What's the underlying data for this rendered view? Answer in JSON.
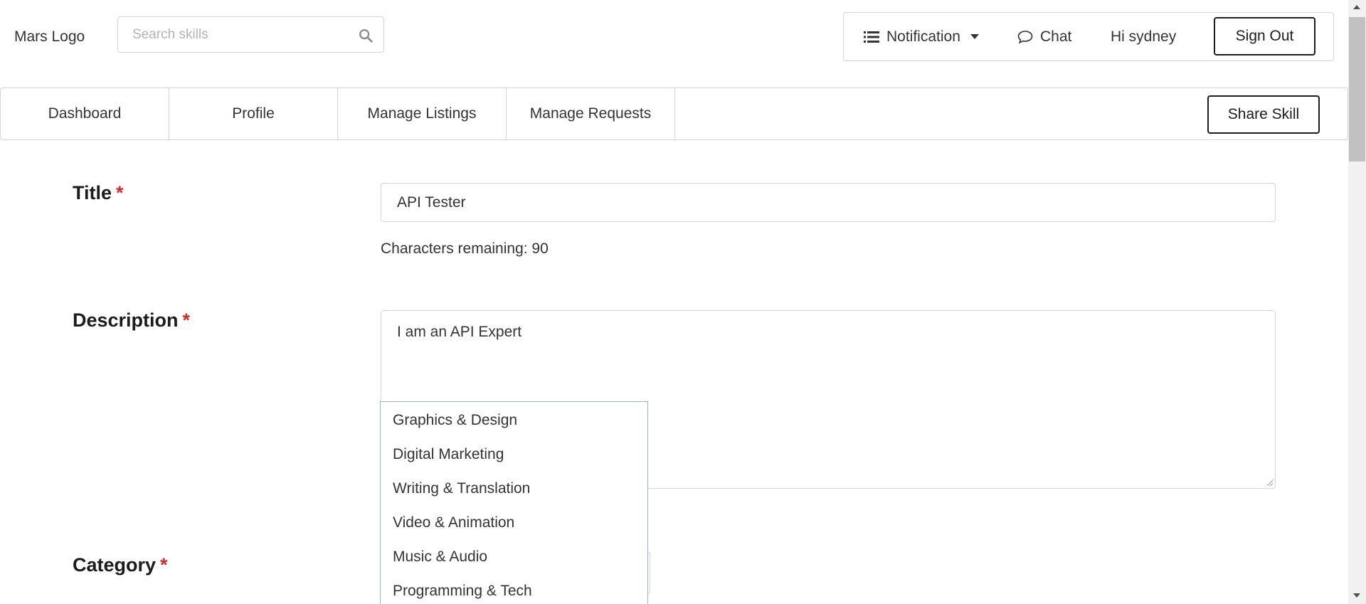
{
  "header": {
    "logo_text": "Mars Logo",
    "search_placeholder": "Search skills",
    "notification_label": "Notification",
    "chat_label": "Chat",
    "greeting": "Hi sydney",
    "signout_label": "Sign Out"
  },
  "nav": {
    "tabs": [
      {
        "label": "Dashboard"
      },
      {
        "label": "Profile"
      },
      {
        "label": "Manage Listings"
      },
      {
        "label": "Manage Requests"
      }
    ],
    "share_label": "Share Skill"
  },
  "form": {
    "title_label": "Title",
    "title_value": "API Tester",
    "chars_remaining": "Characters remaining: 90",
    "description_label": "Description",
    "description_value": "I am an API Expert",
    "category_label": "Category",
    "required_mark": "*"
  },
  "category_dropdown": {
    "options": [
      "Graphics & Design",
      "Digital Marketing",
      "Writing & Translation",
      "Video & Animation",
      "Music & Audio",
      "Programming & Tech"
    ]
  },
  "icons": {
    "search": "search-icon",
    "notification": "list-icon",
    "caret": "caret-down-icon",
    "chat": "chat-bubble-icon"
  },
  "colors": {
    "required": "#db2828",
    "border": "#d4d4d5",
    "dropdown_border": "#96b3d6",
    "button_border": "#1b1c1d"
  }
}
